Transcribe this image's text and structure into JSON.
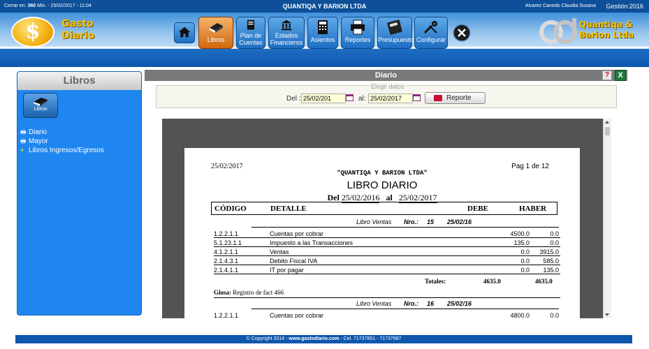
{
  "topbar": {
    "session_prefix": "Cerrar en:",
    "session_minutes": "360",
    "session_suffix": "Min. - 25/02/2017 - 11:04",
    "company": "QUANTIQA Y BARION LTDA",
    "user": "Alvarez Canedo Claudia Susana",
    "gestion": "Gestión:2016"
  },
  "logo": {
    "line1": "Gasto",
    "line2": "Diario"
  },
  "logo_right": {
    "line1": "Quantiqa &",
    "line2": "Barion Ltda"
  },
  "menu": [
    {
      "label": "",
      "icon": "home-icon"
    },
    {
      "label": "Libros",
      "icon": "book-icon",
      "active": true
    },
    {
      "label": "Plan de Cuentas",
      "icon": "ledger-icon"
    },
    {
      "label": "Estados Financieros",
      "icon": "bank-icon"
    },
    {
      "label": "Asientos",
      "icon": "calculator-icon"
    },
    {
      "label": "Reportes",
      "icon": "printer-icon"
    },
    {
      "label": "Presupuesto",
      "icon": "budget-calculator-icon"
    },
    {
      "label": "Configurar",
      "icon": "tools-icon"
    },
    {
      "label": "",
      "icon": "close-icon"
    }
  ],
  "sidebar": {
    "title": "Libros",
    "button_label": "Libros",
    "items": [
      "Diario",
      "Mayor",
      "Libros Ingresos/Egresos"
    ]
  },
  "main": {
    "title": "Diario",
    "filter_legend": "Elegir datos",
    "from_label": "Del :",
    "from_value": "25/02/201",
    "to_label": "al:",
    "to_value": "25/02/2017",
    "report_button": "Reporte"
  },
  "report": {
    "date": "25/02/2017",
    "page": "Pag 1 de 12",
    "company": "\"QUANTIQA Y BARION LTDA\"",
    "title": "LIBRO DIARIO",
    "range_del": "Del",
    "range_from": "25/02/2016",
    "range_al": "al",
    "range_to": "25/02/2017",
    "headers": [
      "CÓDIGO",
      "DETALLE",
      "DEBE",
      "HABER"
    ],
    "groups": [
      {
        "type": "Libro Ventas",
        "nro_label": "Nro.:",
        "nro": "15",
        "date": "25/02/16",
        "rows": [
          {
            "code": "1.2.2.1.1",
            "detail": "Cuentas por cobrar",
            "debe": "4500.0",
            "haber": "0.0"
          },
          {
            "code": "5.1.23.1.1",
            "detail": "Impuesto a las Transacciones",
            "debe": "135.0",
            "haber": "0.0"
          },
          {
            "code": "4.1.2.1.1",
            "detail": "Ventas",
            "debe": "0.0",
            "haber": "3915.0"
          },
          {
            "code": "2.1.4.3.1",
            "detail": "Debito Fiscal IVA",
            "debe": "0.0",
            "haber": "585.0"
          },
          {
            "code": "2.1.4.1.1",
            "detail": "IT por pagar",
            "debe": "0.0",
            "haber": "135.0"
          }
        ],
        "totals_label": "Totales:",
        "total_debe": "4635.0",
        "total_haber": "4635.0",
        "glosa_label": "Glosa:",
        "glosa": "Registro de fact 466"
      },
      {
        "type": "Libro Ventas",
        "nro_label": "Nro.:",
        "nro": "16",
        "date": "25/02/16",
        "rows": [
          {
            "code": "1.2.2.1.1",
            "detail": "Cuentas por cobrar",
            "debe": "4800.0",
            "haber": "0.0"
          }
        ]
      }
    ]
  },
  "footer": {
    "copyright": "© Copyright 2014 -",
    "site": "www.gastodiario.com",
    "phone": "- Cel. 71737851 - 71737687"
  }
}
